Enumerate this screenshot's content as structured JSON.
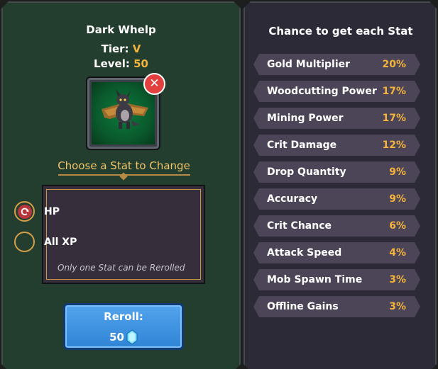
{
  "pet": {
    "name": "Dark Whelp",
    "tier_label": "Tier:",
    "tier_value": "V",
    "level_label": "Level:",
    "level_value": "50"
  },
  "choose": {
    "title": "Choose a Stat to Change",
    "options": [
      {
        "label": "HP",
        "selected": true
      },
      {
        "label": "All XP",
        "selected": false
      }
    ],
    "note": "Only one Stat can be Rerolled"
  },
  "reroll": {
    "label": "Reroll:",
    "cost": "50",
    "currency_icon": "gem-icon"
  },
  "chances": {
    "title": "Chance to get each Stat",
    "stats": [
      {
        "name": "Gold Multiplier",
        "chance": "20%"
      },
      {
        "name": "Woodcutting Power",
        "chance": "17%"
      },
      {
        "name": "Mining Power",
        "chance": "17%"
      },
      {
        "name": "Crit Damage",
        "chance": "12%"
      },
      {
        "name": "Drop Quantity",
        "chance": "9%"
      },
      {
        "name": "Accuracy",
        "chance": "9%"
      },
      {
        "name": "Crit Chance",
        "chance": "6%"
      },
      {
        "name": "Attack Speed",
        "chance": "4%"
      },
      {
        "name": "Mob Spawn Time",
        "chance": "3%"
      },
      {
        "name": "Offline Gains",
        "chance": "3%"
      }
    ]
  },
  "colors": {
    "accent": "#f4b33c",
    "left_panel": "#233d2e",
    "right_panel": "#2d2a37",
    "reroll_button": "#3b8fe0",
    "remove_button": "#e2403f"
  }
}
